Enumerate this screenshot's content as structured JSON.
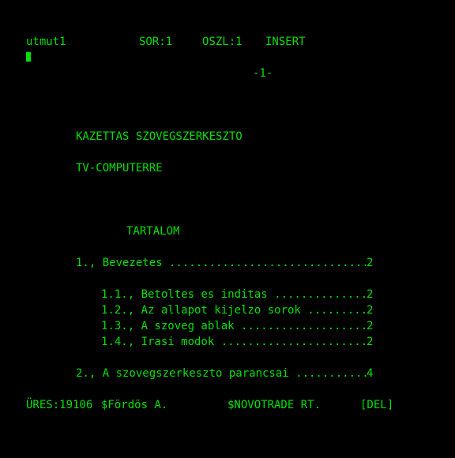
{
  "status_bar": {
    "filename": "utmut1",
    "row": "SOR:1",
    "column": "OSZL:1",
    "mode": "INSERT"
  },
  "page_marker": "-1-",
  "document": {
    "title_line_1": "KAZETTAS SZOVEGSZERKESZTO",
    "title_line_2": "TV-COMPUTERRE",
    "toc_heading": "TARTALOM",
    "toc": [
      {
        "text": "1., Bevezetes ..............................",
        "page": "2"
      },
      {
        "text": "1.1., Betoltes es inditas ..............",
        "page": "2"
      },
      {
        "text": "1.2., Az allapot kijelzo sorok .........",
        "page": "2"
      },
      {
        "text": "1.3., A szoveg ablak ...................",
        "page": "2"
      },
      {
        "text": "1.4., Irasi modok ......................",
        "page": "2"
      },
      {
        "text": "2., A szovegszerkeszto parancsai ...........",
        "page": "4"
      }
    ]
  },
  "footer": {
    "free": "ÜRES:19106",
    "author": "$Fördös A.",
    "company": "$NOVOTRADE RT.",
    "key": "[DEL]"
  },
  "colors": {
    "foreground": "#00e000",
    "background": "#000000"
  }
}
